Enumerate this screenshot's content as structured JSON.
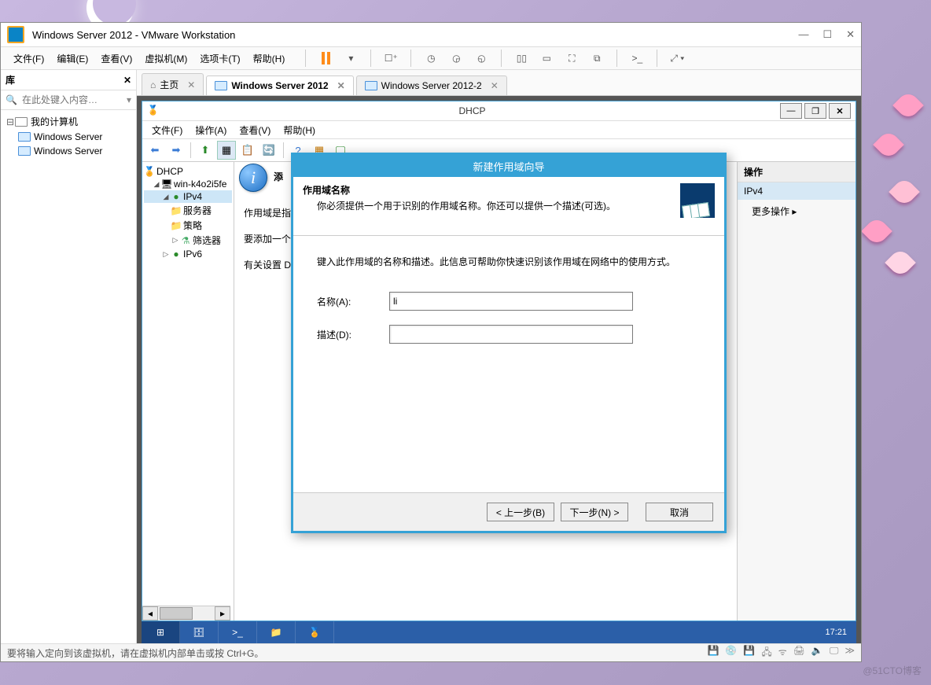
{
  "vmware": {
    "title": "Windows Server 2012 - VMware Workstation",
    "menu": {
      "file": "文件(F)",
      "edit": "编辑(E)",
      "view": "查看(V)",
      "vm": "虚拟机(M)",
      "tabs": "选项卡(T)",
      "help": "帮助(H)"
    },
    "sidebar": {
      "title": "库",
      "search_placeholder": "在此处键入内容…",
      "root": "我的计算机",
      "items": [
        "Windows Server",
        "Windows Server"
      ]
    },
    "tabs": [
      {
        "label": "主页",
        "type": "home"
      },
      {
        "label": "Windows Server 2012",
        "type": "vm",
        "active": true
      },
      {
        "label": "Windows Server 2012-2",
        "type": "vm"
      }
    ],
    "status": "要将输入定向到该虚拟机，请在虚拟机内部单击或按 Ctrl+G。"
  },
  "mmc": {
    "title": "DHCP",
    "menu": {
      "file": "文件(F)",
      "action": "操作(A)",
      "view": "查看(V)",
      "help": "帮助(H)"
    },
    "tree": {
      "root": "DHCP",
      "server": "win-k4o2i5fe",
      "ipv4": "IPv4",
      "ipv4_children": [
        "服务器",
        "策略",
        "筛选器"
      ],
      "ipv6": "IPv6"
    },
    "center": {
      "line1": "作用域是指",
      "line2": "要添加一个",
      "line3": "有关设置 D",
      "head": "添"
    },
    "actions": {
      "title": "操作",
      "section": "IPv4",
      "more": "更多操作"
    }
  },
  "wizard": {
    "title": "新建作用域向导",
    "header": {
      "bold": "作用域名称",
      "sub": "你必须提供一个用于识别的作用域名称。你还可以提供一个描述(可选)。"
    },
    "hint": "键入此作用域的名称和描述。此信息可帮助你快速识别该作用域在网络中的使用方式。",
    "name_label": "名称(A):",
    "name_value": "li",
    "desc_label": "描述(D):",
    "desc_value": "",
    "back": "< 上一步(B)",
    "next": "下一步(N) >",
    "cancel": "取消"
  },
  "taskbar": {
    "clock": "17:21"
  },
  "watermark": "@51CTO博客"
}
